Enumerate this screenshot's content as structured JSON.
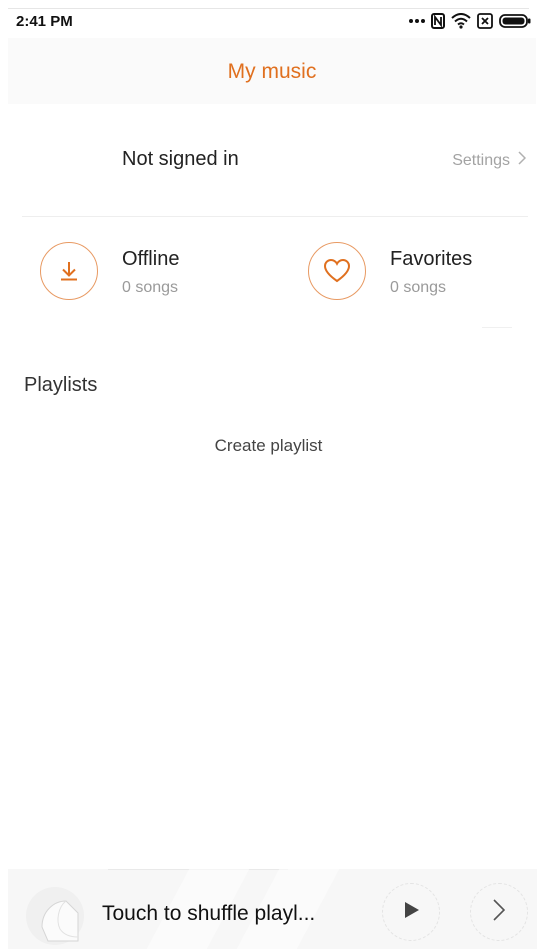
{
  "status_bar": {
    "time": "2:41 PM",
    "icons": [
      "more-dots-icon",
      "nfc-icon",
      "wifi-icon",
      "no-sim-icon",
      "battery-icon"
    ]
  },
  "header": {
    "title": "My music"
  },
  "account": {
    "status": "Not signed in",
    "settings_label": "Settings"
  },
  "shortcuts": [
    {
      "title": "Offline",
      "count": "0 songs",
      "icon": "download-icon"
    },
    {
      "title": "Favorites",
      "count": "0 songs",
      "icon": "heart-icon"
    }
  ],
  "playlists": {
    "section_title": "Playlists",
    "create_label": "Create playlist"
  },
  "mini_player": {
    "track_text": "Touch to shuffle playl...",
    "icons": [
      "album-art-icon",
      "play-icon",
      "chevron-right-icon"
    ]
  },
  "colors": {
    "accent": "#e0701f",
    "accent_light": "#e89a63",
    "muted_text": "#9a9a9a",
    "header_bg": "#fafafa",
    "player_bg": "#f7f7f7"
  }
}
